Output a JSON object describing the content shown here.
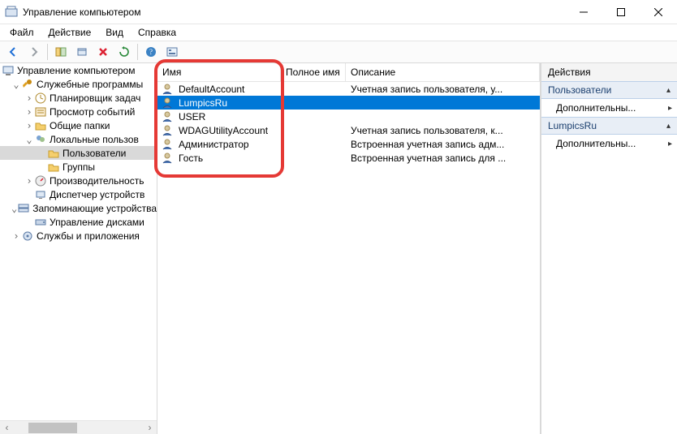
{
  "window": {
    "title": "Управление компьютером"
  },
  "menubar": {
    "file": "Файл",
    "action": "Действие",
    "view": "Вид",
    "help": "Справка"
  },
  "tree": {
    "root": "Управление компьютером",
    "svc": "Служебные программы",
    "sched": "Планировщик задач",
    "event": "Просмотр событий",
    "shared": "Общие папки",
    "local": "Локальные пользов",
    "users": "Пользователи",
    "groups": "Группы",
    "perf": "Производительность",
    "devmgr": "Диспетчер устройств",
    "storage": "Запоминающие устройства",
    "diskmgr": "Управление дисками",
    "services": "Службы и приложения"
  },
  "columns": {
    "name": "Имя",
    "fullName": "Полное имя",
    "description": "Описание"
  },
  "users": [
    {
      "name": "DefaultAccount",
      "full": "",
      "desc": "Учетная запись пользователя, у..."
    },
    {
      "name": "LumpicsRu",
      "full": "",
      "desc": "",
      "selected": true
    },
    {
      "name": "USER",
      "full": "",
      "desc": ""
    },
    {
      "name": "WDAGUtilityAccount",
      "full": "",
      "desc": "Учетная запись пользователя, к..."
    },
    {
      "name": "Администратор",
      "full": "",
      "desc": "Встроенная учетная запись адм..."
    },
    {
      "name": "Гость",
      "full": "",
      "desc": "Встроенная учетная запись для ..."
    }
  ],
  "actions": {
    "header": "Действия",
    "group1": "Пользователи",
    "more1": "Дополнительны...",
    "group2": "LumpicsRu",
    "more2": "Дополнительны..."
  }
}
